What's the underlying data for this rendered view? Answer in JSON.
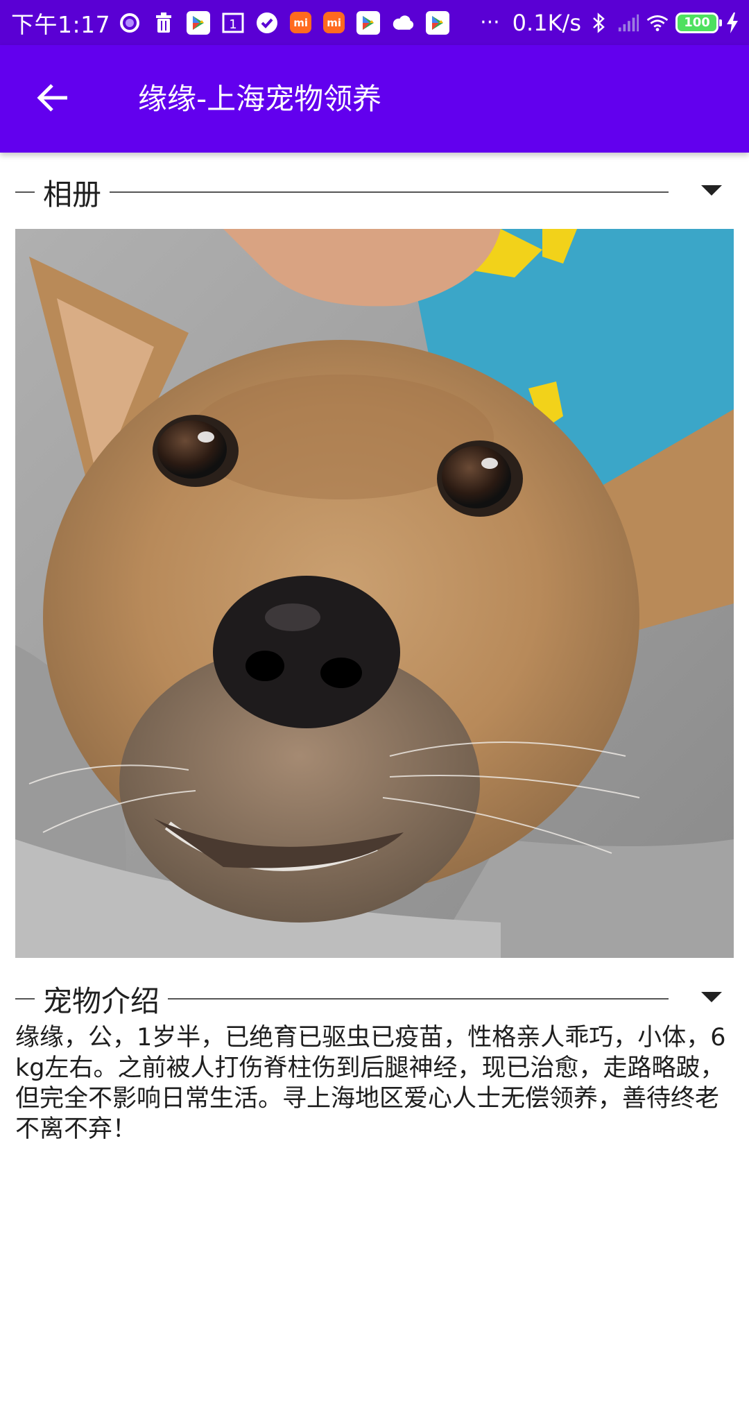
{
  "status_bar": {
    "time": "下午1:17",
    "network_speed": "0.1K/s",
    "battery_level": "100",
    "icons": [
      "circle-icon",
      "trash-icon",
      "play-store-icon",
      "one-icon",
      "check-icon",
      "mi-icon",
      "mi-icon",
      "play-store-icon",
      "cloud-icon",
      "play-store-icon",
      "more-icon",
      "bluetooth-icon",
      "signal-icon",
      "wifi-icon",
      "battery-icon",
      "charging-icon"
    ],
    "mi_label": "mi",
    "one_label": "1",
    "more_label": "···"
  },
  "app_bar": {
    "title": "缘缘-上海宠物领养",
    "back_icon": "arrow-left-icon",
    "color": "#6200ee"
  },
  "album": {
    "section_title": "相册",
    "expand_icon": "triangle-down-icon"
  },
  "pet_intro": {
    "section_title": "宠物介绍",
    "expand_icon": "triangle-down-icon",
    "description": "缘缘，公，1岁半，已绝育已驱虫已疫苗，性格亲人乖巧，小体，6kg左右。之前被人打伤脊柱伤到后腿神经，现已治愈，走路略跛，但完全不影响日常生活。寻上海地区爱心人士无偿领养，善待终老不离不弃！"
  },
  "colors": {
    "status_bar": "#5a00d4",
    "app_bar": "#6200ee",
    "text": "#202020"
  }
}
